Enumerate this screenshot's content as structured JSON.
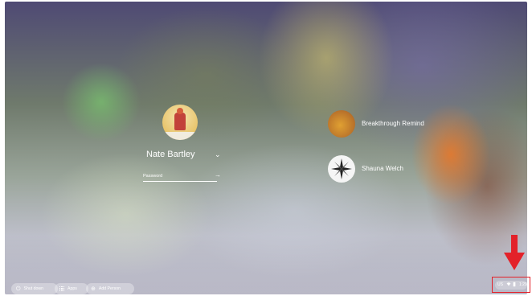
{
  "login": {
    "selected_user": {
      "name": "Nate Bartley",
      "password_placeholder": "Password"
    },
    "other_users": [
      {
        "name": "Breakthrough Remind"
      },
      {
        "name": "Shauna Welch"
      }
    ]
  },
  "shelf": {
    "shutdown_label": "Shut down",
    "apps_label": "Apps",
    "add_person_label": "Add Person"
  },
  "tray": {
    "ime": "US",
    "time": "1:29"
  },
  "colors": {
    "annotation": "#e3222a"
  }
}
